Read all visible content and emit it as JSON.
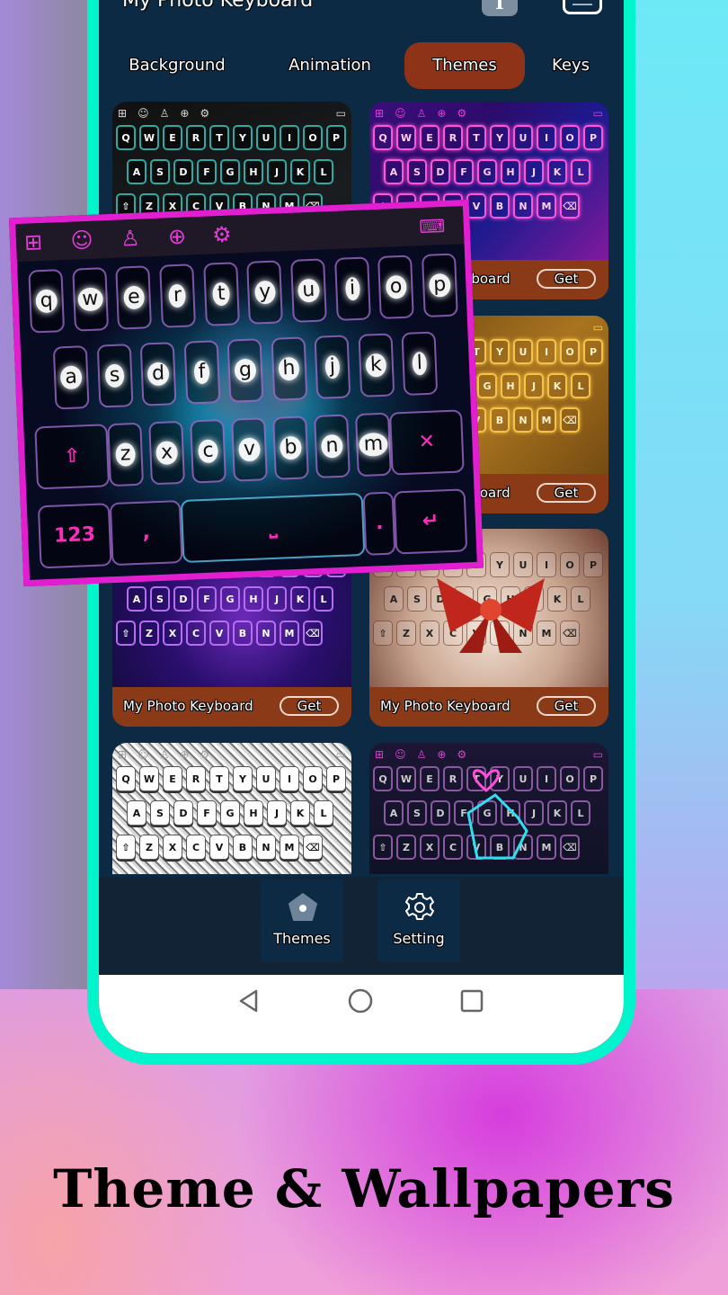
{
  "app": {
    "title": "My Photo Keyboard",
    "font_icon": "text-size-icon",
    "menu_icon": "menu-icon"
  },
  "tabs": [
    {
      "label": "Background",
      "active": false
    },
    {
      "label": "Animation",
      "active": false
    },
    {
      "label": "Themes",
      "active": true
    },
    {
      "label": "Keys",
      "active": false
    }
  ],
  "colors": {
    "accent_tab": "#8e3318",
    "phone_frame": "#00f5cc",
    "screen_bg": "#0c2a43",
    "card_footer": "#8b3a18",
    "highlight_border": "#e21fd0"
  },
  "themes": [
    {
      "name": "",
      "style": "teal-hex",
      "get_label": ""
    },
    {
      "name": "My Photo Keyboard",
      "style": "neon-laser",
      "get_label": "Get"
    },
    {
      "name": "My Photo Keyboard",
      "style": "gold-sparkle",
      "get_label": "Get"
    },
    {
      "name": "My Photo Keyboard",
      "style": "neon-ring",
      "get_label": "Get"
    },
    {
      "name": "My Photo Keyboard",
      "style": "red-bow",
      "get_label": "Get"
    },
    {
      "name": "",
      "style": "silver-glitter",
      "get_label": ""
    },
    {
      "name": "",
      "style": "neon-heart-hand",
      "get_label": ""
    }
  ],
  "keyboard_preview": {
    "row1": [
      "Q",
      "W",
      "E",
      "R",
      "T",
      "Y",
      "U",
      "I",
      "O",
      "P"
    ],
    "row2": [
      "A",
      "S",
      "D",
      "F",
      "G",
      "H",
      "J",
      "K",
      "L"
    ],
    "row3": [
      "⇧",
      "Z",
      "X",
      "C",
      "V",
      "B",
      "N",
      "M",
      "⌫"
    ]
  },
  "featured_keyboard": {
    "toolbar_icons": [
      "apps-icon",
      "emoji-icon",
      "shirt-icon",
      "globe-icon",
      "settings-icon",
      "keyboard-hide-icon"
    ],
    "row1": [
      "q",
      "w",
      "e",
      "r",
      "t",
      "y",
      "u",
      "i",
      "o",
      "p"
    ],
    "row2": [
      "a",
      "s",
      "d",
      "f",
      "g",
      "h",
      "j",
      "k",
      "l"
    ],
    "row3": [
      "z",
      "x",
      "c",
      "v",
      "b",
      "n",
      "m"
    ],
    "numbers_key": "123",
    "comma_key": ",",
    "period_key": ".",
    "enter_key": "↵",
    "shift_key": "⇧",
    "delete_key": "✕"
  },
  "bottom_nav": [
    {
      "label": "Themes",
      "icon": "pentagon-icon"
    },
    {
      "label": "Setting",
      "icon": "gear-icon"
    }
  ],
  "system_nav": [
    "back-icon",
    "home-icon",
    "recents-icon"
  ],
  "caption": "Theme & Wallpapers"
}
